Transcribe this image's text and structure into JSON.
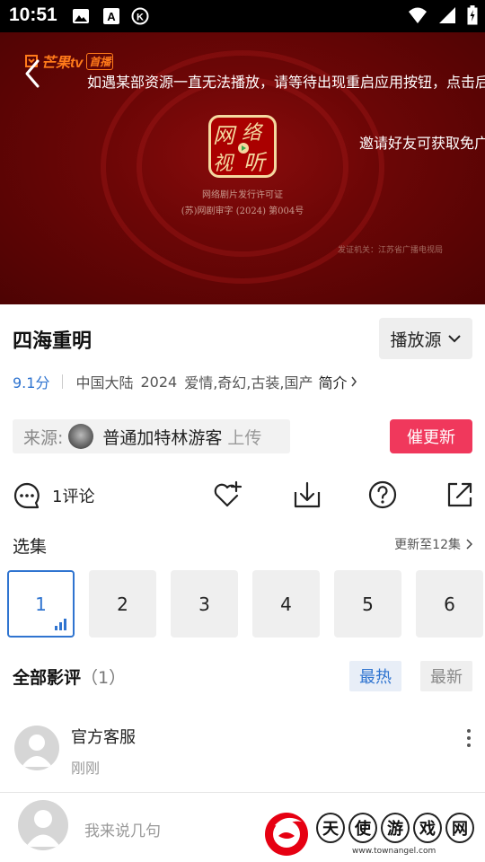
{
  "status_bar": {
    "time": "10:51",
    "icons_left": [
      "image-icon",
      "a-letter-icon",
      "k-circle-icon"
    ],
    "icons_right": [
      "wifi-icon",
      "signal-icon",
      "battery-icon"
    ]
  },
  "player": {
    "logo_text": "芒果tv",
    "logo_badge": "首播",
    "notice": "如遇某部资源一直无法播放，请等待出现重启应用按钮，点击后",
    "invite": "邀请好友可获取免广",
    "license_line1": "网络剧片发行许可证",
    "license_line2": "(苏)网剧审字 (2024) 第004号",
    "license_issuer": "发证机关：江苏省广播电视局",
    "seal_text": "网络视听"
  },
  "show": {
    "title": "四海重明",
    "source_button": "播放源",
    "score": "9.1分",
    "region": "中国大陆",
    "year": "2024",
    "genres": "爱情,奇幻,古装,国产",
    "intro_label": "简介"
  },
  "uploader": {
    "label": "来源:",
    "name": "普通加特林游客",
    "action": "上传"
  },
  "update_button": "催更新",
  "actions": {
    "comment_label": "1评论",
    "icons": [
      "favorite-add-icon",
      "download-icon",
      "help-icon",
      "share-icon"
    ]
  },
  "episodes": {
    "title": "选集",
    "update_status": "更新至12集",
    "items": [
      "1",
      "2",
      "3",
      "4",
      "5",
      "6"
    ],
    "selected": "1"
  },
  "reviews": {
    "title": "全部影评",
    "count": "（1）",
    "tab_hot": "最热",
    "tab_new": "最新",
    "comment": {
      "author": "官方客服",
      "time": "刚刚"
    }
  },
  "composer": {
    "placeholder": "我来说几句"
  },
  "watermark": {
    "chars": [
      "天",
      "使",
      "游",
      "戏",
      "网"
    ],
    "url": "www.townangel.com"
  },
  "colors": {
    "accent_blue": "#2f74d0",
    "update_red": "#f0385c",
    "video_bg": "#6c0606"
  }
}
